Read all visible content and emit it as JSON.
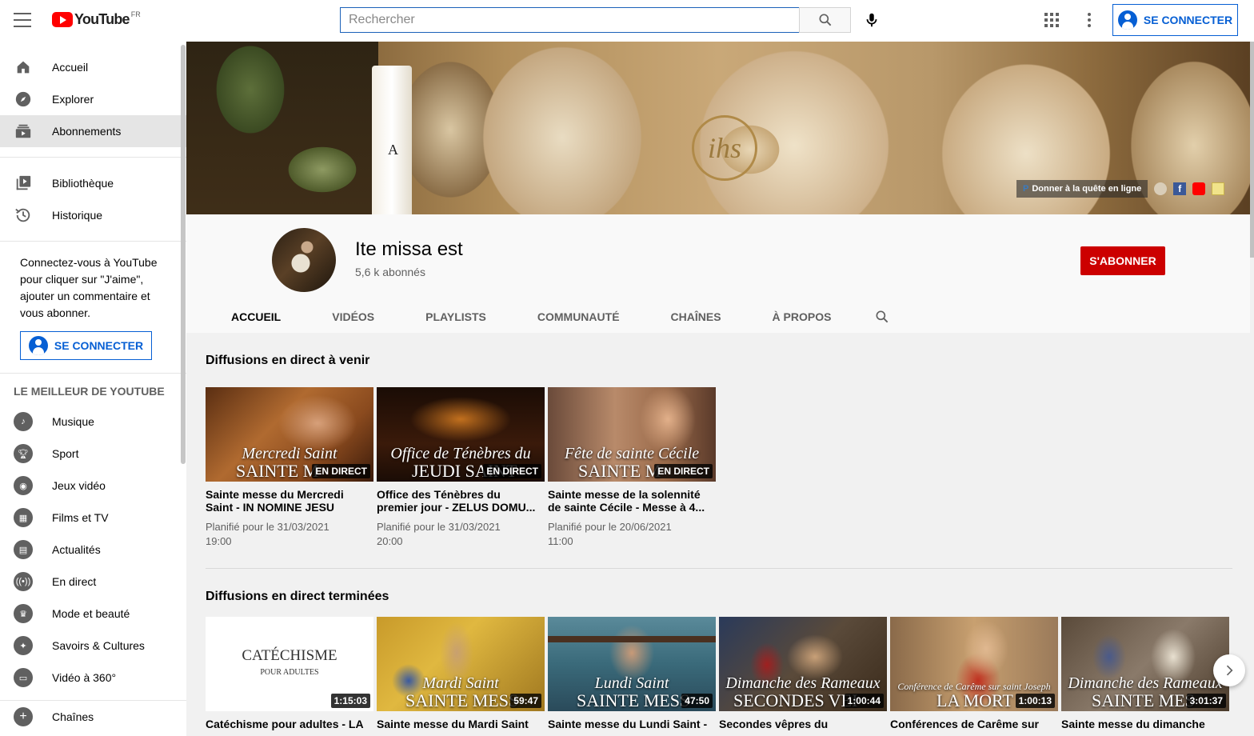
{
  "header": {
    "logo_text": "YouTube",
    "logo_country": "FR",
    "search_placeholder": "Rechercher",
    "signin_label": "SE CONNECTER"
  },
  "sidebar": {
    "main_items": [
      {
        "label": "Accueil",
        "icon": "home-icon"
      },
      {
        "label": "Explorer",
        "icon": "compass-icon"
      },
      {
        "label": "Abonnements",
        "icon": "subscriptions-icon",
        "active": true
      }
    ],
    "library_items": [
      {
        "label": "Bibliothèque",
        "icon": "library-icon"
      },
      {
        "label": "Historique",
        "icon": "history-icon"
      }
    ],
    "signin_prompt": "Connectez-vous à YouTube pour cliquer sur \"J'aime\", ajouter un commentaire et vous abonner.",
    "signin_label": "SE CONNECTER",
    "best_heading": "LE MEILLEUR DE YOUTUBE",
    "best_items": [
      {
        "label": "Musique",
        "icon": "music-icon"
      },
      {
        "label": "Sport",
        "icon": "trophy-icon"
      },
      {
        "label": "Jeux vidéo",
        "icon": "gaming-icon"
      },
      {
        "label": "Films et TV",
        "icon": "film-icon"
      },
      {
        "label": "Actualités",
        "icon": "news-icon"
      },
      {
        "label": "En direct",
        "icon": "live-icon"
      },
      {
        "label": "Mode et beauté",
        "icon": "fashion-icon"
      },
      {
        "label": "Savoirs & Cultures",
        "icon": "lightbulb-icon"
      },
      {
        "label": "Vidéo à 360°",
        "icon": "vr-icon"
      }
    ],
    "channels_label": "Chaînes"
  },
  "banner": {
    "donate_label": "Donner à la quête en ligne"
  },
  "channel": {
    "name": "Ite missa est",
    "subscribers": "5,6 k abonnés",
    "subscribe_label": "S'ABONNER",
    "tabs": [
      "ACCUEIL",
      "VIDÉOS",
      "PLAYLISTS",
      "COMMUNAUTÉ",
      "CHAÎNES",
      "À PROPOS"
    ],
    "active_tab": "ACCUEIL"
  },
  "sections": {
    "upcoming_title": "Diffusions en direct à venir",
    "upcoming": [
      {
        "thumb_line1": "Mercredi Saint",
        "thumb_line2": "SAINTE M",
        "badge": "EN DIRECT",
        "title": "Sainte messe du Mercredi Saint - IN NOMINE JESU",
        "meta1": "Planifié pour le 31/03/2021",
        "meta2": "19:00",
        "bg": "#8a4a1e"
      },
      {
        "thumb_line1": "Office de Ténèbres du",
        "thumb_line2": "JEUDI SAINT",
        "badge": "EN DIRECT",
        "title": "Office des Ténèbres du premier jour - ZELUS DOMU...",
        "meta1": "Planifié pour le 31/03/2021",
        "meta2": "20:00",
        "bg": "#2a140a"
      },
      {
        "thumb_line1": "Fête de sainte Cécile",
        "thumb_line2": "SAINTE M",
        "badge": "EN DIRECT",
        "title": "Sainte messe de la solennité de sainte Cécile - Messe à 4...",
        "meta1": "Planifié pour le 20/06/2021",
        "meta2": "11:00",
        "bg": "#9a6a4a"
      }
    ],
    "past_title": "Diffusions en direct terminées",
    "past": [
      {
        "thumb_line1": "CATÉCHISME",
        "thumb_line2": "POUR ADULTES",
        "badge": "1:15:03",
        "title": "Catéchisme pour adultes - LA",
        "bg": "#ffffff",
        "plain": true
      },
      {
        "thumb_line1": "Mardi Saint",
        "thumb_line2": "SAINTE MESS",
        "badge": "59:47",
        "title": "Sainte messe du Mardi Saint",
        "bg": "#b48a2a"
      },
      {
        "thumb_line1": "Lundi Saint",
        "thumb_line2": "SAINTE MESS",
        "badge": "47:50",
        "title": "Sainte messe du Lundi Saint -",
        "bg": "#4a7a8a"
      },
      {
        "thumb_line1": "Dimanche des Rameaux",
        "thumb_line2": "SECONDES VEI",
        "badge": "1:00:44",
        "title": "Secondes vêpres du",
        "bg": "#3a2a2a"
      },
      {
        "thumb_line1": "Conférence de Carême sur saint Joseph",
        "thumb_line2": "LA MORT",
        "badge": "1:00:13",
        "title": "Conférences de Carême sur",
        "bg": "#b0683a"
      },
      {
        "thumb_line1": "Dimanche des Rameaux",
        "thumb_line2": "SAINTE MES",
        "badge": "3:01:37",
        "title": "Sainte messe du dimanche",
        "bg": "#6a5a4a"
      }
    ]
  },
  "colors": {
    "accent_blue": "#065fd4",
    "subscribe_red": "#cc0000",
    "youtube_red": "#ff0000"
  }
}
